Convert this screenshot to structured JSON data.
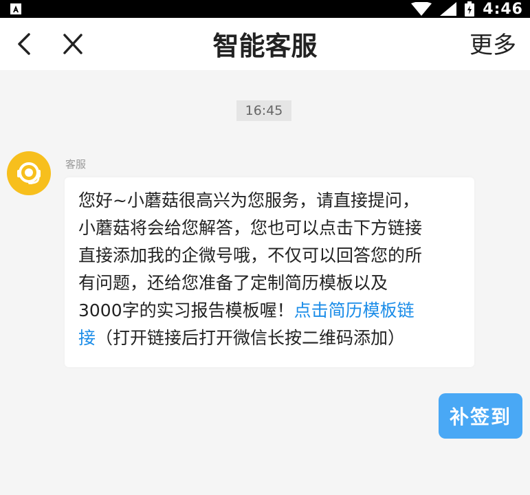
{
  "status_bar": {
    "time": "4:46",
    "icons": [
      "notification-icon",
      "wifi-icon",
      "signal-icon",
      "battery-icon"
    ]
  },
  "header": {
    "title": "智能客服",
    "more_label": "更多",
    "icons": [
      "back-chevron-icon",
      "close-icon"
    ]
  },
  "chat": {
    "timestamp": "16:45",
    "message": {
      "sender": "客服",
      "avatar_icon": "headset-icon",
      "avatar_color": "#f7bf1d",
      "text_line1": "您好~小蘑菇很高兴为您服务，请直接提问，",
      "text_line2": "小蘑菇将会给您解答，您也可以点击下方链接",
      "text_line3": "直接添加我的企微号哦，不仅可以回答您的所",
      "text_line4": "有问题，还给您准备了定制简历模板以及",
      "text_line5_plain": "3000字的实习报告模板喔！",
      "link_part1": "点击简历模板链",
      "link_part2": "接",
      "text_line6_tail": "（打开链接后打开微信长按二维码添加）"
    }
  },
  "action_button": {
    "label": "补签到",
    "color": "#49a8f5"
  },
  "colors": {
    "link": "#1a8ce8",
    "background": "#f5f5f5"
  }
}
